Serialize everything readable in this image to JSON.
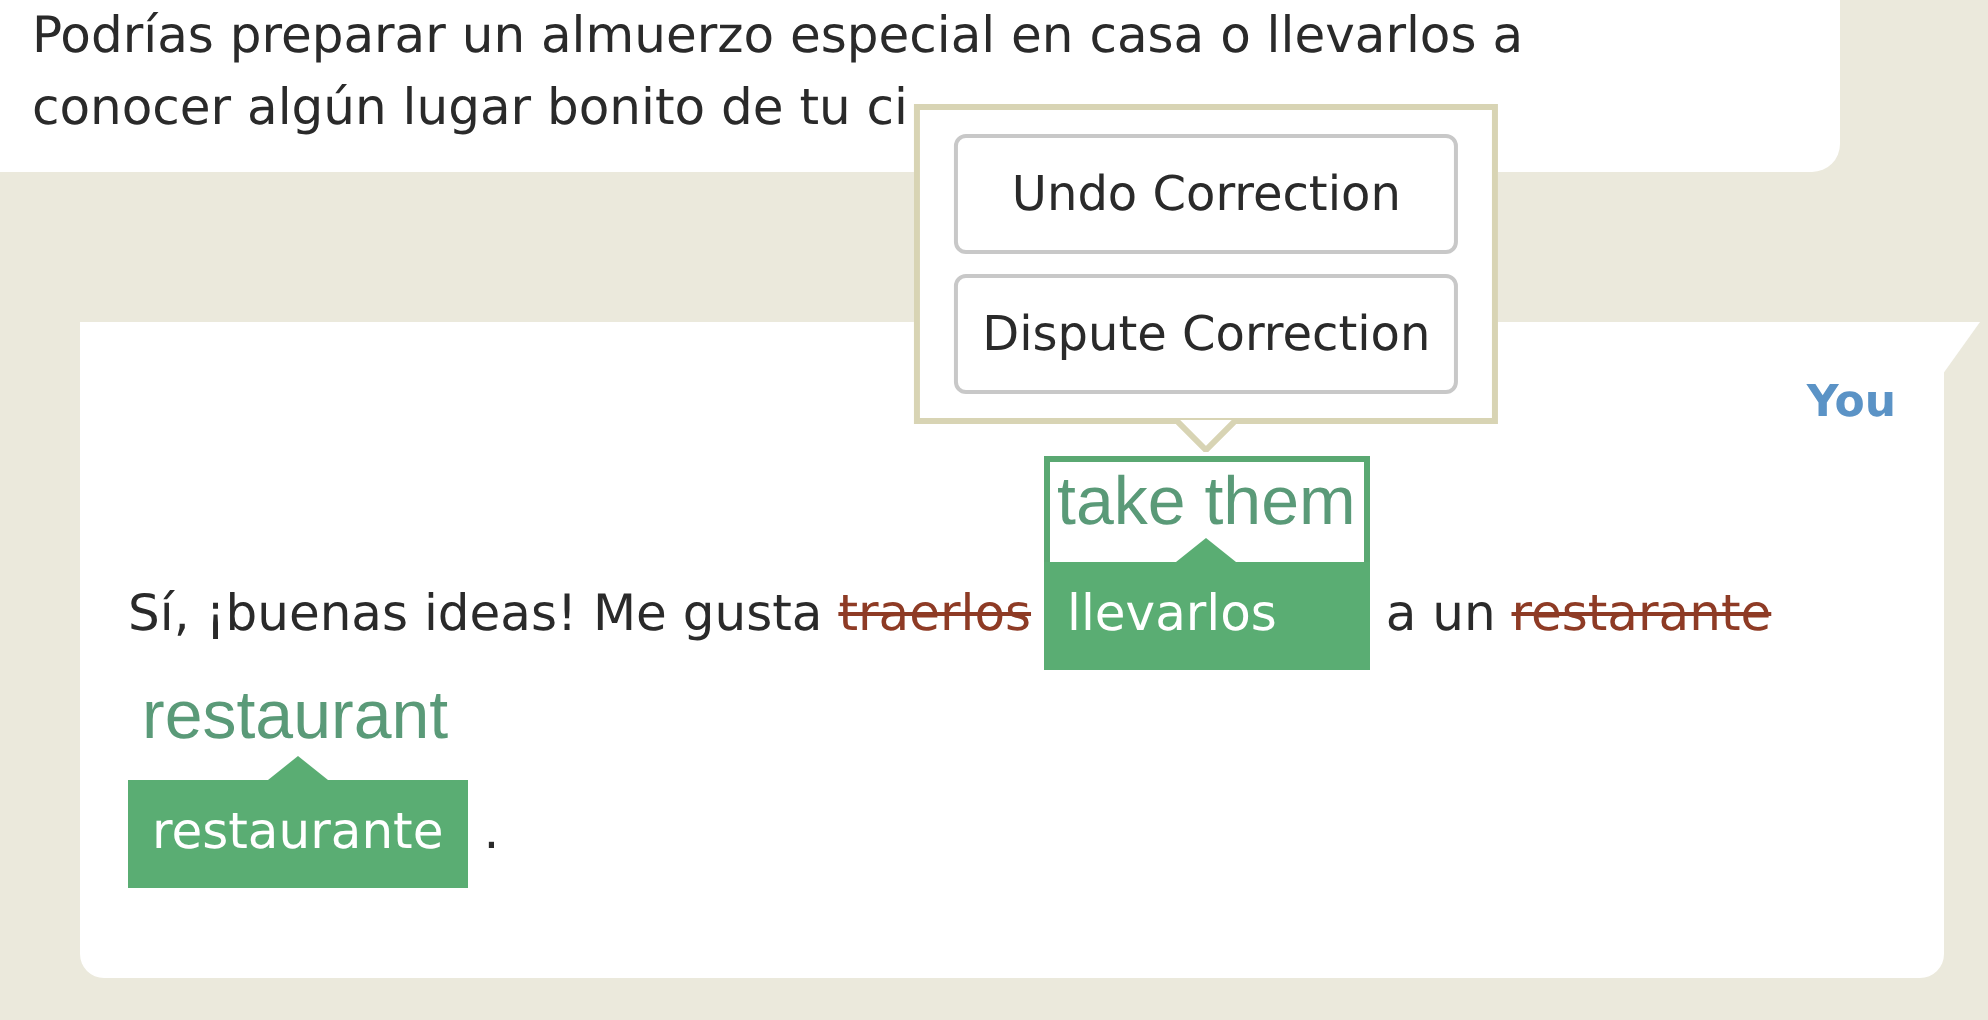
{
  "previous_message": {
    "lines": [
      "Podrías preparar un almuerzo especial en casa o llevarlos a",
      "conocer algún lugar bonito de tu ci"
    ]
  },
  "message": {
    "author": "You",
    "segments": [
      {
        "kind": "text",
        "text": "Sí, ¡buenas ideas! Me gusta"
      },
      {
        "kind": "correction",
        "original": "traerlos",
        "gloss": "take them",
        "corrected": "llevarlos",
        "selected": true
      },
      {
        "kind": "text",
        "text": "a un"
      },
      {
        "kind": "correction",
        "original": "restarante",
        "gloss": "restaurant",
        "corrected": "restaurante",
        "selected": false
      },
      {
        "kind": "text",
        "text": "."
      }
    ]
  },
  "popover": {
    "buttons": [
      "Undo Correction",
      "Dispute Correction"
    ]
  }
}
